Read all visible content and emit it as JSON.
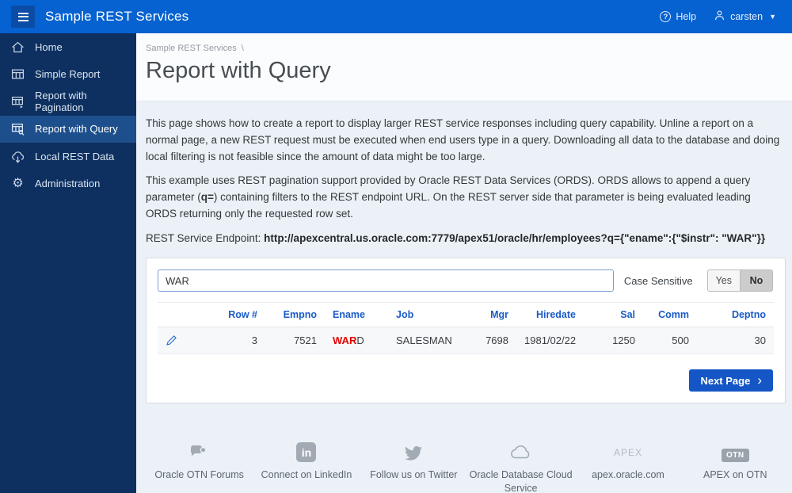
{
  "header": {
    "title": "Sample REST Services",
    "help_label": "Help",
    "user_label": "carsten"
  },
  "sidebar": {
    "items": [
      {
        "label": "Home",
        "icon": "home-icon",
        "selected": false
      },
      {
        "label": "Simple Report",
        "icon": "table-icon",
        "selected": false
      },
      {
        "label": "Report with Pagination",
        "icon": "table-pagination-icon",
        "selected": false
      },
      {
        "label": "Report with Query",
        "icon": "table-search-icon",
        "selected": true
      },
      {
        "label": "Local REST Data",
        "icon": "cloud-download-icon",
        "selected": false
      },
      {
        "label": "Administration",
        "icon": "gear-icon",
        "selected": false
      }
    ]
  },
  "main": {
    "breadcrumb": "Sample REST Services",
    "breadcrumb_separator": "\\",
    "page_title": "Report with Query",
    "paragraph1": "This page shows how to create a report to display larger REST service responses including query capability. Unline a report on a normal page, a new REST request must be executed when end users type in a query. Downloading all data to the database and doing local filtering is not feasible since the amount of data might be too large.",
    "paragraph2_part1": "This example uses REST pagination support provided by Oracle REST Data Services (ORDS). ORDS allows to append a query parameter (",
    "paragraph2_bold": "q=",
    "paragraph2_part2": ") containing filters to the REST endpoint URL. On the REST server side that parameter is being evaluated leading ORDS returning only the requested row set.",
    "endpoint_label": "REST Service Endpoint: ",
    "endpoint_url": "http://apexcentral.us.oracle.com:7779/apex51/oracle/hr/employees?q={\"ename\":{\"$instr\": \"WAR\"}}"
  },
  "report": {
    "search_value": "WAR",
    "case_sensitive_label": "Case Sensitive",
    "yes_label": "Yes",
    "no_label": "No",
    "selected_option": "No",
    "columns": [
      "Row #",
      "Empno",
      "Ename",
      "Job",
      "Mgr",
      "Hiredate",
      "Sal",
      "Comm",
      "Deptno"
    ],
    "row": {
      "row_num": "3",
      "empno": "7521",
      "ename_highlight": "WAR",
      "ename_rest": "D",
      "job": "SALESMAN",
      "mgr": "7698",
      "hiredate": "1981/02/22",
      "sal": "1250",
      "comm": "500",
      "deptno": "30"
    },
    "next_page_label": "Next Page"
  },
  "footer": {
    "items": [
      {
        "label": "Oracle OTN Forums",
        "icon": "forum-icon"
      },
      {
        "label": "Connect on LinkedIn",
        "icon": "linkedin-icon"
      },
      {
        "label": "Follow us on Twitter",
        "icon": "twitter-icon"
      },
      {
        "label": "Oracle Database Cloud Service",
        "icon": "cloud-icon"
      },
      {
        "label": "apex.oracle.com",
        "icon": "apex-text-icon",
        "icon_text": "APEX"
      },
      {
        "label": "APEX on OTN",
        "icon": "otn-badge-icon",
        "icon_text": "OTN"
      }
    ]
  },
  "colors": {
    "header_bg": "#0562d0",
    "hamburger_bg": "#0b4da6",
    "sidebar_bg": "#0d3060",
    "sidebar_selected_bg": "#1d4f8c",
    "content_bg": "#ebf1f7",
    "card_bg": "#ffffff",
    "column_header_blue": "#1a5bc8",
    "next_button_blue": "#1556c6",
    "highlight_red": "#e50000"
  }
}
